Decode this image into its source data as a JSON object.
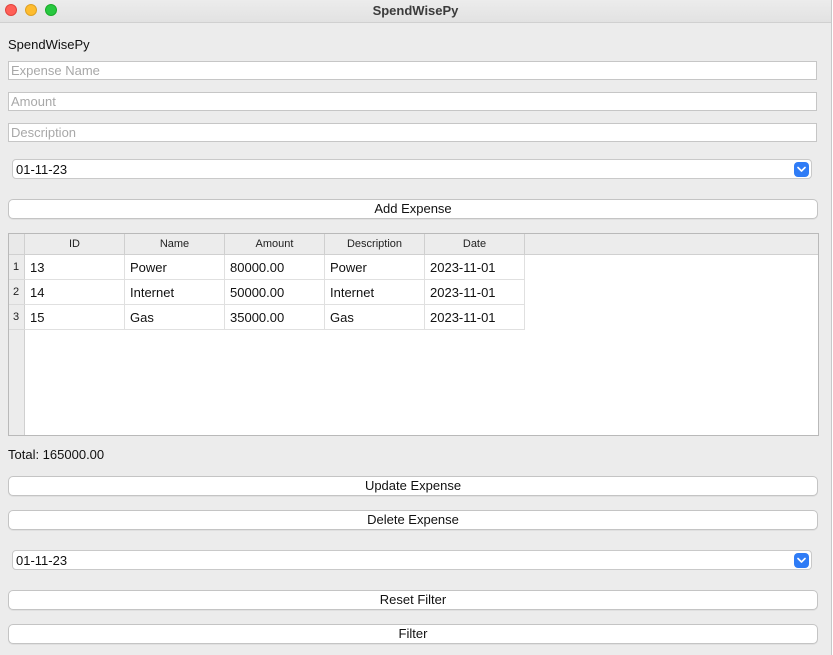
{
  "window": {
    "title": "SpendWisePy"
  },
  "app": {
    "label": "SpendWisePy"
  },
  "form": {
    "expense_name_placeholder": "Expense Name",
    "amount_placeholder": "Amount",
    "description_placeholder": "Description",
    "date_value": "01-11-23",
    "add_button": "Add Expense"
  },
  "table": {
    "columns": [
      "ID",
      "Name",
      "Amount",
      "Description",
      "Date"
    ],
    "row_headers": [
      "1",
      "2",
      "3"
    ],
    "rows": [
      [
        "13",
        "Power",
        "80000.00",
        "Power",
        "2023-11-01"
      ],
      [
        "14",
        "Internet",
        "50000.00",
        "Internet",
        "2023-11-01"
      ],
      [
        "15",
        "Gas",
        "35000.00",
        "Gas",
        "2023-11-01"
      ]
    ]
  },
  "total": "Total: 165000.00",
  "actions": {
    "update_button": "Update Expense",
    "delete_button": "Delete Expense",
    "filter_date_value": "01-11-23",
    "reset_filter_button": "Reset Filter",
    "filter_button": "Filter"
  },
  "colors": {
    "accent": "#2f7cf6",
    "close": "#ff5f57",
    "minimize": "#febc2e",
    "maximize": "#28c840"
  }
}
